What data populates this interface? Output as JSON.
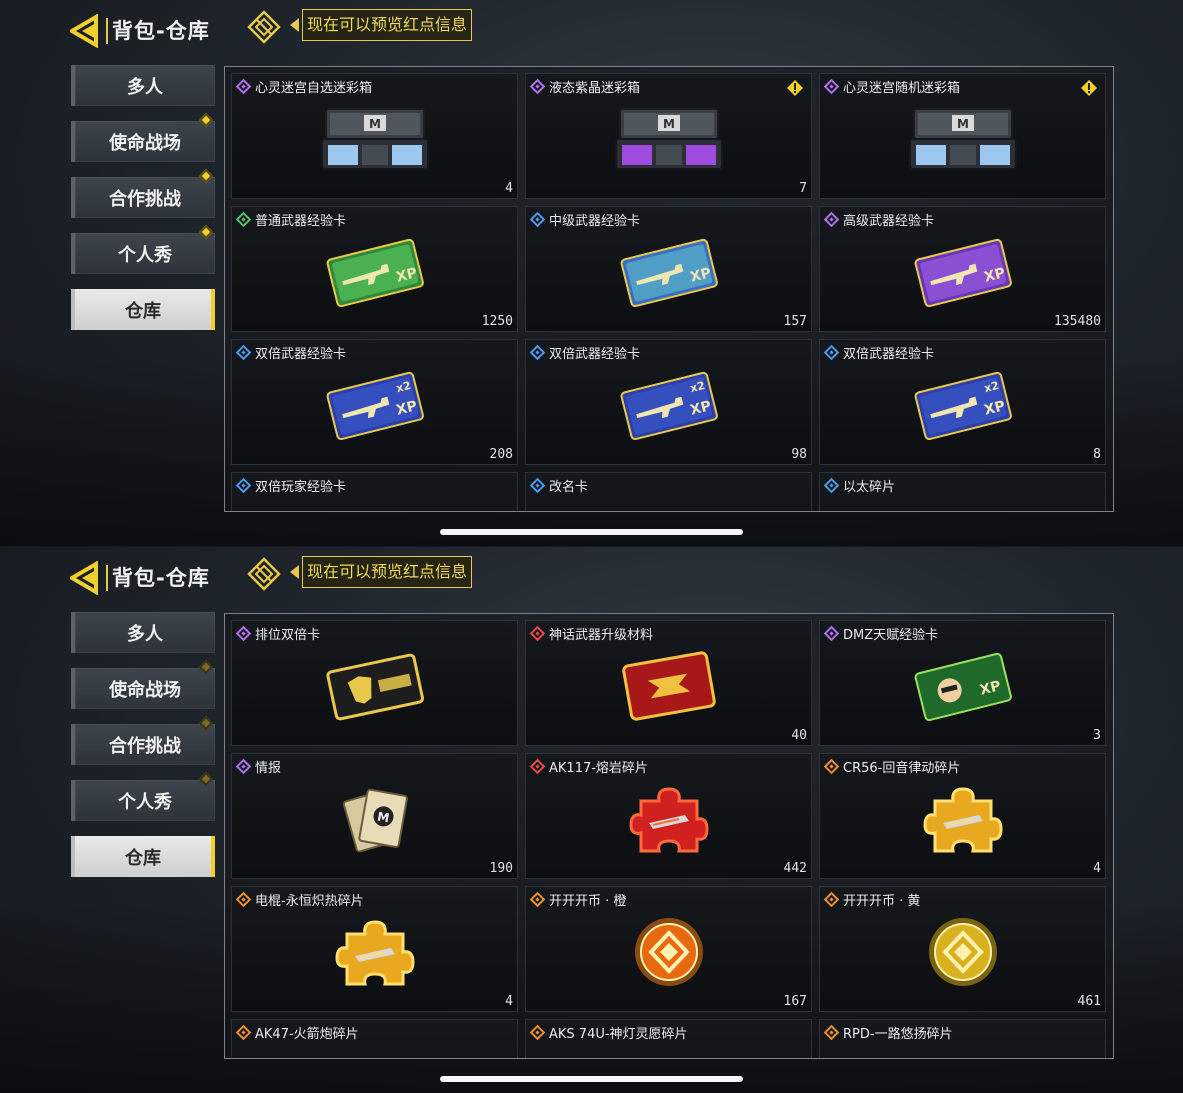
{
  "header": {
    "title": "背包-仓库",
    "preview_text": "现在可以预览红点信息"
  },
  "sidebar": {
    "items": [
      {
        "label": "多人",
        "dot": false
      },
      {
        "label": "使命战场",
        "dot": true
      },
      {
        "label": "合作挑战",
        "dot": true
      },
      {
        "label": "个人秀",
        "dot": true
      },
      {
        "label": "仓库",
        "dot": false,
        "active": true
      }
    ]
  },
  "colors": {
    "accent": "#f2cf2a",
    "rarity_purple": "#b06ef0",
    "rarity_green": "#4ec46a",
    "rarity_blue": "#4a9cf0",
    "rarity_red": "#f04848",
    "rarity_orange": "#f0902a"
  },
  "screen1": {
    "items": [
      {
        "name": "心灵迷宫自选迷彩箱",
        "count": "4",
        "rarity": "purple",
        "icon": "crate-blue-icon",
        "alert": false
      },
      {
        "name": "液态紫晶迷彩箱",
        "count": "7",
        "rarity": "purple",
        "icon": "crate-purple-icon",
        "alert": true
      },
      {
        "name": "心灵迷宫随机迷彩箱",
        "count": "",
        "rarity": "purple",
        "icon": "crate-blue-icon",
        "alert": true
      },
      {
        "name": "普通武器经验卡",
        "count": "1250",
        "rarity": "green",
        "icon": "xp-card-green-icon",
        "alert": false
      },
      {
        "name": "中级武器经验卡",
        "count": "157",
        "rarity": "blue",
        "icon": "xp-card-blue-icon",
        "alert": false
      },
      {
        "name": "高级武器经验卡",
        "count": "135480",
        "rarity": "purple",
        "icon": "xp-card-purple-icon",
        "alert": false
      },
      {
        "name": "双倍武器经验卡",
        "count": "208",
        "rarity": "blue",
        "icon": "xp-x2-card-icon",
        "alert": false
      },
      {
        "name": "双倍武器经验卡",
        "count": "98",
        "rarity": "blue",
        "icon": "xp-x2-card-icon",
        "alert": false
      },
      {
        "name": "双倍武器经验卡",
        "count": "8",
        "rarity": "blue",
        "icon": "xp-x2-card-icon",
        "alert": false
      },
      {
        "name": "双倍玩家经验卡",
        "count": "",
        "rarity": "blue",
        "icon": "",
        "alert": false
      },
      {
        "name": "改名卡",
        "count": "",
        "rarity": "blue",
        "icon": "",
        "alert": false
      },
      {
        "name": "以太碎片",
        "count": "",
        "rarity": "blue",
        "icon": "",
        "alert": false
      }
    ]
  },
  "screen2": {
    "items": [
      {
        "name": "排位双倍卡",
        "count": "",
        "rarity": "purple",
        "icon": "ranked-card-icon",
        "alert": false
      },
      {
        "name": "神话武器升级材料",
        "count": "40",
        "rarity": "red",
        "icon": "mythic-material-icon",
        "alert": false
      },
      {
        "name": "DMZ天赋经验卡",
        "count": "3",
        "rarity": "purple",
        "icon": "dmz-xp-card-icon",
        "alert": false
      },
      {
        "name": "情报",
        "count": "190",
        "rarity": "purple",
        "icon": "intel-cards-icon",
        "alert": false
      },
      {
        "name": "AK117-熔岩碎片",
        "count": "442",
        "rarity": "red",
        "icon": "puzzle-red-icon",
        "alert": false
      },
      {
        "name": "CR56-回音律动碎片",
        "count": "4",
        "rarity": "orange",
        "icon": "puzzle-gold-icon",
        "alert": false
      },
      {
        "name": "电棍-永恒炽热碎片",
        "count": "4",
        "rarity": "orange",
        "icon": "puzzle-gold-icon",
        "alert": false
      },
      {
        "name": "开开开币 · 橙",
        "count": "167",
        "rarity": "orange",
        "icon": "coin-orange-icon",
        "alert": false
      },
      {
        "name": "开开开币 · 黄",
        "count": "461",
        "rarity": "orange",
        "icon": "coin-yellow-icon",
        "alert": false
      },
      {
        "name": "AK47-火箭炮碎片",
        "count": "",
        "rarity": "orange",
        "icon": "",
        "alert": false
      },
      {
        "name": "AKS 74U-神灯灵愿碎片",
        "count": "",
        "rarity": "orange",
        "icon": "",
        "alert": false
      },
      {
        "name": "RPD-一路悠扬碎片",
        "count": "",
        "rarity": "orange",
        "icon": "",
        "alert": false
      }
    ]
  }
}
